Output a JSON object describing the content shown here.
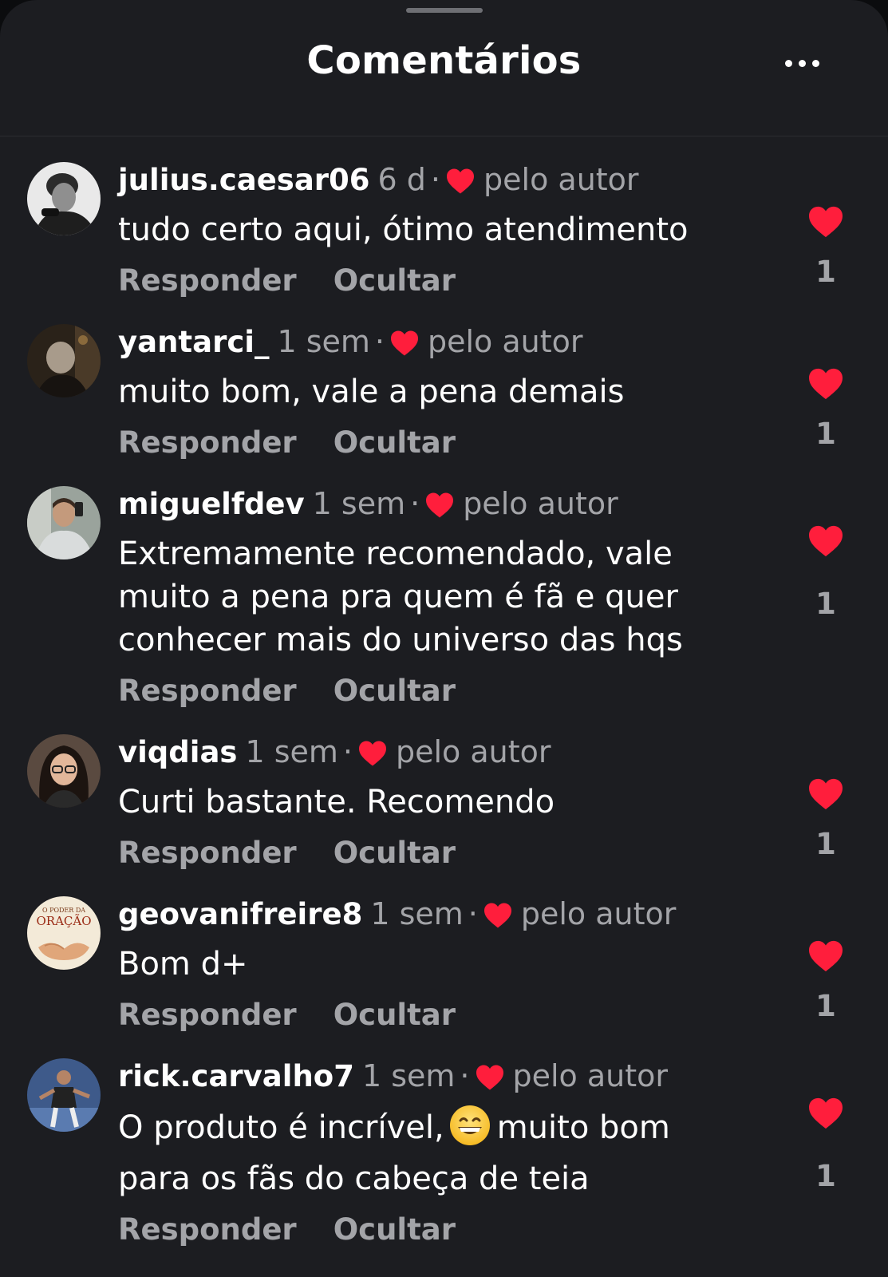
{
  "header": {
    "title": "Comentários"
  },
  "colors": {
    "background": "#1c1d21",
    "heart": "#ff1e3c",
    "muted_text": "#a3a4a8"
  },
  "comments": [
    {
      "username": "julius.caesar06",
      "time": "6 d",
      "separator": "·",
      "liked_by_author": "pelo autor",
      "text": "tudo certo aqui, ótimo atendimento",
      "reply": "Responder",
      "hide": "Ocultar",
      "likes": "1",
      "avatar": "avatar-photo-selfie-bw"
    },
    {
      "username": "yantarci_",
      "time": "1 sem",
      "separator": "·",
      "liked_by_author": "pelo autor",
      "text": "muito bom, vale a pena demais",
      "reply": "Responder",
      "hide": "Ocultar",
      "likes": "1",
      "avatar": "avatar-photo-dark"
    },
    {
      "username": "miguelfdev",
      "time": "1 sem",
      "separator": "·",
      "liked_by_author": "pelo autor",
      "text": "Extremamente recomendado, vale muito a pena pra quem é fã e quer conhecer mais do universo das hqs",
      "reply": "Responder",
      "hide": "Ocultar",
      "likes": "1",
      "avatar": "avatar-photo-mirror-selfie"
    },
    {
      "username": "viqdias",
      "time": "1 sem",
      "separator": "·",
      "liked_by_author": "pelo autor",
      "text": "Curti bastante. Recomendo",
      "reply": "Responder",
      "hide": "Ocultar",
      "likes": "1",
      "avatar": "avatar-photo-woman"
    },
    {
      "username": "geovanifreire8",
      "time": "1 sem",
      "separator": "·",
      "liked_by_author": "pelo autor",
      "text": "Bom d+",
      "reply": "Responder",
      "hide": "Ocultar",
      "likes": "1",
      "avatar": "avatar-oracao-logo",
      "avatar_text_top": "O PODER DA",
      "avatar_text_main": "ORAÇÃO"
    },
    {
      "username": "rick.carvalho7",
      "time": "1 sem",
      "separator": "·",
      "liked_by_author": "pelo autor",
      "text_before_emoji": "O produto é incrível,",
      "emoji": "grinning-face-emoji",
      "text_after_emoji": "muito bom para os fãs do cabeça de teia",
      "reply": "Responder",
      "hide": "Ocultar",
      "likes": "1",
      "avatar": "avatar-photo-soccer"
    }
  ]
}
